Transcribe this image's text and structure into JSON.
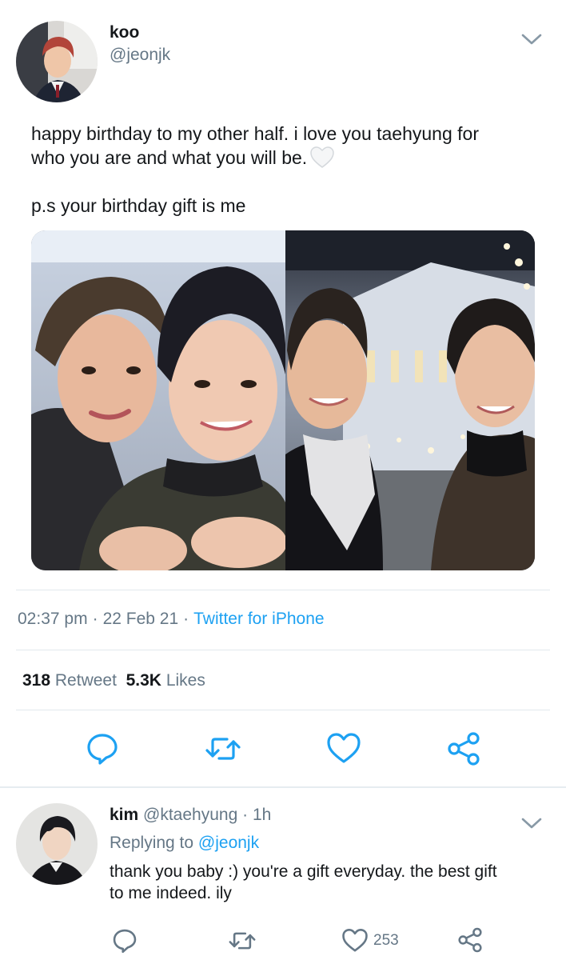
{
  "tweet": {
    "author": {
      "name": "koo",
      "handle": "@jeonjk"
    },
    "text_lines": [
      "happy birthday to my other half. i love you taehyung for",
      "who you are and what you will be."
    ],
    "ps_line": "p.s your birthday gift is me",
    "time": "02:37 pm",
    "date": "22 Feb 21",
    "source": "Twitter for iPhone",
    "separator": "·",
    "retweets": {
      "count": "318",
      "label": "Retweet"
    },
    "likes": {
      "count": "5.3K",
      "label": "Likes"
    }
  },
  "reply": {
    "author": {
      "name": "kim",
      "handle": "@ktaehyung"
    },
    "separator": "·",
    "time": "1h",
    "replying_prefix": "Replying to",
    "replying_to": "@jeonjk",
    "text_lines": [
      "thank you baby :) you're a gift everyday. the best gift",
      "to me indeed. ily"
    ],
    "like_count": "253"
  },
  "icons": {
    "reply": "speech-bubble-icon",
    "retweet": "retweet-arrows-icon",
    "like": "heart-outline-icon",
    "share": "share-nodes-icon",
    "more": "chevron-down-icon",
    "emoji": "white-heart-emoji"
  },
  "colors": {
    "link": "#1da1f2",
    "muted": "#657786",
    "text": "#14171a",
    "divider": "#e1e8ed"
  }
}
